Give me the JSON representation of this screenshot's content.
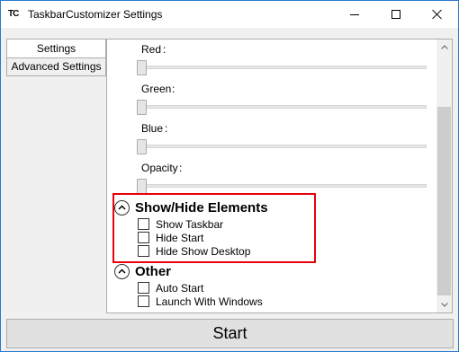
{
  "window": {
    "title": "TaskbarCustomizer Settings",
    "icon_text": "TC"
  },
  "tabs": [
    {
      "label": "Settings",
      "selected": true
    },
    {
      "label": "Advanced Settings",
      "selected": false
    }
  ],
  "sliders": [
    {
      "label": "Red",
      "value": 0
    },
    {
      "label": "Green",
      "value": 0
    },
    {
      "label": "Blue",
      "value": 0
    },
    {
      "label": "Opacity",
      "value": 0
    }
  ],
  "sections": [
    {
      "title": "Show/Hide Elements",
      "expanded": true,
      "items": [
        {
          "label": "Show Taskbar",
          "checked": false
        },
        {
          "label": "Hide Start",
          "checked": false
        },
        {
          "label": "Hide Show Desktop",
          "checked": false
        }
      ]
    },
    {
      "title": "Other",
      "expanded": true,
      "items": [
        {
          "label": "Auto Start",
          "checked": false
        },
        {
          "label": "Launch With Windows",
          "checked": false
        }
      ]
    }
  ],
  "footer": {
    "start_label": "Start"
  },
  "colors": {
    "highlight": "#e8000c",
    "window_border": "#2b79d0"
  }
}
